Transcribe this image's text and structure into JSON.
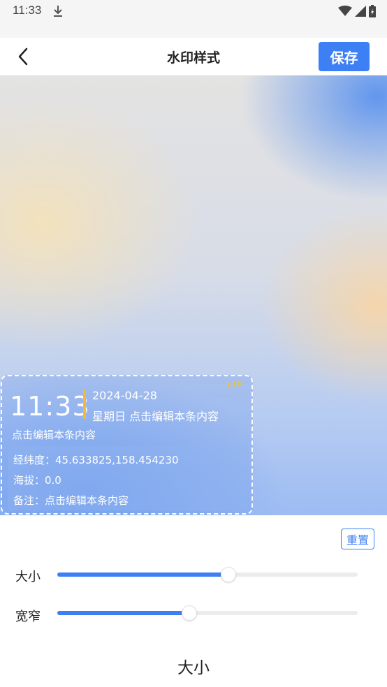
{
  "status_bar": {
    "time": "11:33",
    "icons": [
      "download-icon",
      "wifi-icon",
      "signal-icon",
      "battery-icon"
    ]
  },
  "header": {
    "title": "水印样式",
    "save_label": "保存"
  },
  "watermark": {
    "time": "11:33",
    "date": "2024-04-28",
    "weekday_line": "星期日 点击编辑本条内容",
    "vip_label": "VIP",
    "line1": "点击编辑本条内容",
    "rows": [
      "经纬度：45.633825,158.454230",
      "海拔：0.0",
      "备注：点击编辑本条内容"
    ]
  },
  "controls": {
    "reset_label": "重置",
    "sliders": [
      {
        "label": "大小",
        "value": 0.57
      },
      {
        "label": "宽窄",
        "value": 0.44
      }
    ]
  },
  "bottom_title": "大小",
  "colors": {
    "accent": "#3d7ff5",
    "vip_gold": "#e9c04c",
    "time_bar": "#f4b73a"
  }
}
